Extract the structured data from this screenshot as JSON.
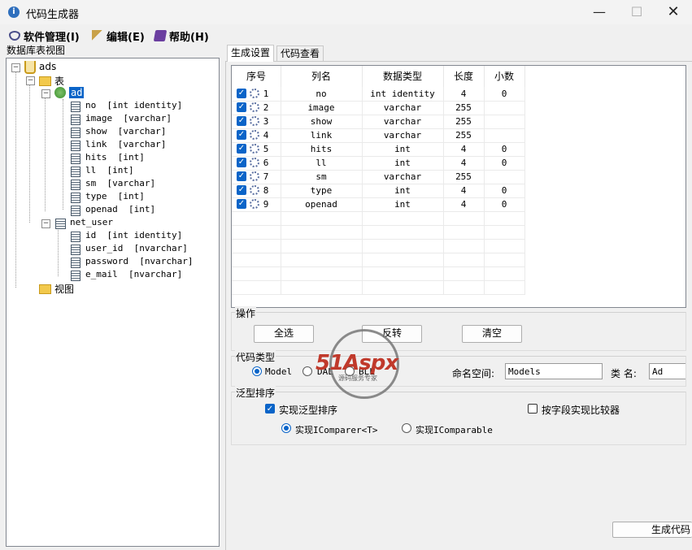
{
  "window": {
    "title": "代码生成器",
    "min_glyph": "—",
    "max_glyph": "☐",
    "close_glyph": "✕"
  },
  "menu": {
    "software": "软件管理(I)",
    "edit": "编辑(E)",
    "help": "帮助(H)"
  },
  "tree": {
    "label": "数据库表视图",
    "db": "ads",
    "tables_folder": "表",
    "views_folder": "视图",
    "tables": [
      {
        "name": "ad",
        "columns": [
          "no  [int identity]",
          "image  [varchar]",
          "show  [varchar]",
          "link  [varchar]",
          "hits  [int]",
          "ll  [int]",
          "sm  [varchar]",
          "type  [int]",
          "openad  [int]"
        ]
      },
      {
        "name": "net_user",
        "columns": [
          "id  [int identity]",
          "user_id  [nvarchar]",
          "password  [nvarchar]",
          "e_mail  [nvarchar]"
        ]
      }
    ]
  },
  "tabs": {
    "gen": "生成设置",
    "view": "代码查看"
  },
  "grid": {
    "headers": [
      "序号",
      "列名",
      "数据类型",
      "长度",
      "小数"
    ],
    "rows": [
      [
        "1",
        "no",
        "int identity",
        "4",
        "0"
      ],
      [
        "2",
        "image",
        "varchar",
        "255",
        ""
      ],
      [
        "3",
        "show",
        "varchar",
        "255",
        ""
      ],
      [
        "4",
        "link",
        "varchar",
        "255",
        ""
      ],
      [
        "5",
        "hits",
        "int",
        "4",
        "0"
      ],
      [
        "6",
        "ll",
        "int",
        "4",
        "0"
      ],
      [
        "7",
        "sm",
        "varchar",
        "255",
        ""
      ],
      [
        "8",
        "type",
        "int",
        "4",
        "0"
      ],
      [
        "9",
        "openad",
        "int",
        "4",
        "0"
      ]
    ]
  },
  "ops": {
    "label": "操作",
    "select_all": "全选",
    "invert": "反转",
    "clear": "清空"
  },
  "code_type": {
    "label": "代码类型",
    "options": [
      "Model",
      "DAL",
      "BLL"
    ],
    "selected": "Model",
    "ns_label": "命名空间:",
    "ns_value": "Models",
    "class_label": "类 名:",
    "class_value": "Ad"
  },
  "generic_sort": {
    "label": "泛型排序",
    "impl_sort": "实现泛型排序",
    "impl_sort_checked": true,
    "by_field": "按字段实现比较器",
    "by_field_checked": false,
    "icomparer": "实现IComparer<T>",
    "icomparable": "实现IComparable",
    "selected": "icomparer"
  },
  "generate_button": "生成代码",
  "watermark": {
    "brand": "51Aspx",
    "tagline": "源码服务专家"
  },
  "colors": {
    "accent": "#0a64c8",
    "selection": "#0a64c8",
    "folder": "#f2c94c"
  }
}
